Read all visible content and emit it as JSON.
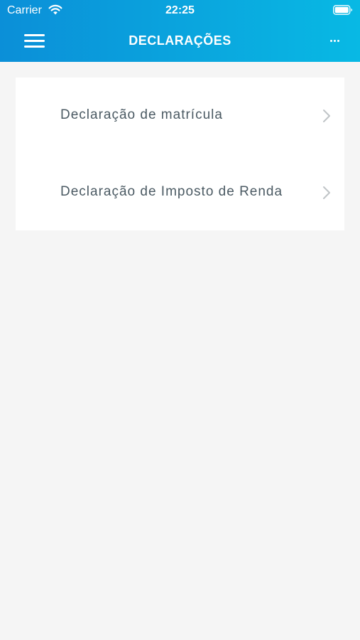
{
  "status_bar": {
    "carrier": "Carrier",
    "time": "22:25",
    "wifi_icon": "wifi-icon",
    "battery_icon": "battery-icon"
  },
  "header": {
    "title": "DECLARAÇÕES",
    "menu_icon": "hamburger-menu-icon",
    "more_icon": "more-dots-icon",
    "gradient_start": "#0b8fd8",
    "gradient_end": "#08b9e4"
  },
  "list": {
    "items": [
      {
        "label": "Declaração de matrícula",
        "icon": "chevron-right-icon"
      },
      {
        "label": "Declaração de Imposto de Renda",
        "icon": "chevron-right-icon"
      }
    ]
  },
  "colors": {
    "background": "#f5f5f5",
    "card": "#ffffff",
    "item_text": "#4b5a63",
    "chevron": "#c0c4c7"
  }
}
